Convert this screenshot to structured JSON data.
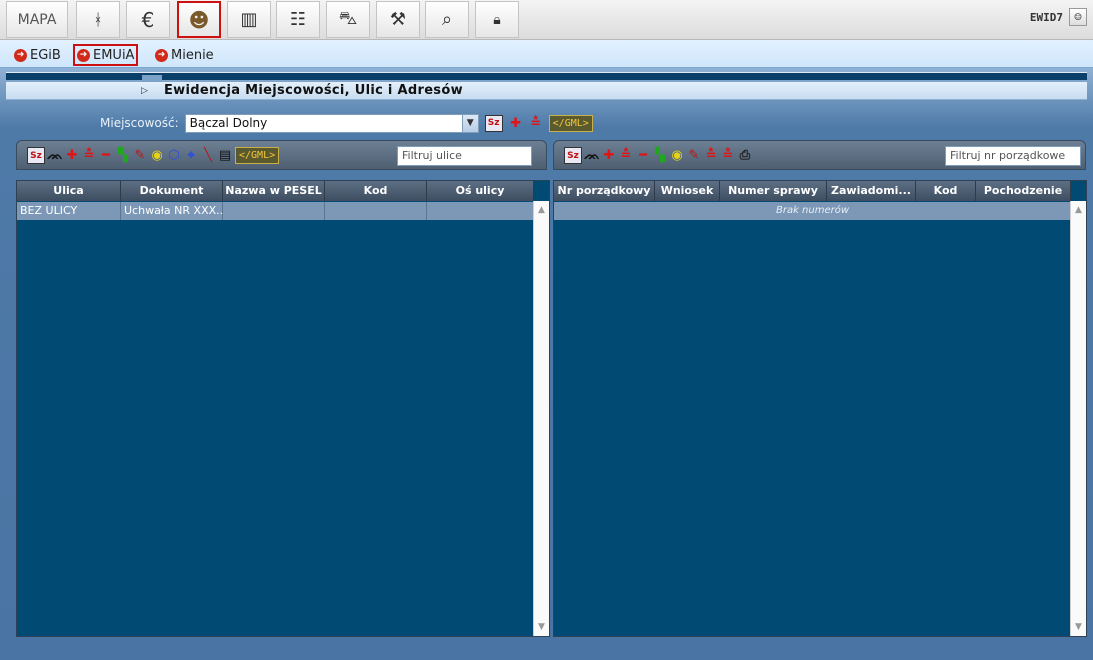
{
  "toolbar": {
    "mapa_label": "MAPA",
    "buttons": [
      {
        "icon": "surveyor-icon",
        "glyph": "⚗"
      },
      {
        "icon": "euro-icon",
        "glyph": "€"
      },
      {
        "icon": "person-icon",
        "glyph": "👤",
        "active": true
      },
      {
        "icon": "building-icon",
        "glyph": "🏢"
      },
      {
        "icon": "cabinet-icon",
        "glyph": "☷"
      },
      {
        "icon": "cart-icon",
        "glyph": "🛒"
      },
      {
        "icon": "gavel-icon",
        "glyph": "⚖"
      },
      {
        "icon": "search-icon",
        "glyph": "🔍"
      },
      {
        "icon": "lock-icon",
        "glyph": "🔒"
      }
    ],
    "user_label": "EWID7"
  },
  "subnav": {
    "items": [
      {
        "label": "EGiB",
        "active": false
      },
      {
        "label": "EMUiA",
        "active": true
      },
      {
        "label": "Mienie",
        "active": false
      }
    ]
  },
  "section": {
    "title": "Ewidencja Miejscowości, Ulic i Adresów"
  },
  "locality": {
    "label": "Miejscowość:",
    "value": "Bączal Dolny",
    "gml": "</GML>",
    "sz": "Sz"
  },
  "streets": {
    "filter_placeholder": "Filtruj ulice",
    "gml": "</GML>",
    "sz": "Sz",
    "columns": [
      "Ulica",
      "Dokument",
      "Nazwa w PESEL",
      "Kod",
      "Oś ulicy"
    ],
    "rows": [
      [
        "BEZ ULICY",
        "Uchwała NR XXX...",
        "",
        "",
        ""
      ]
    ]
  },
  "numbers": {
    "filter_placeholder": "Filtruj nr porządkowe",
    "sz": "Sz",
    "columns": [
      "Nr porządkowy",
      "Wniosek",
      "Numer sprawy",
      "Zawiadomi...",
      "Kod",
      "Pochodzenie"
    ],
    "empty_text": "Brak numerów"
  },
  "colors": {
    "accent_red": "#cc1111",
    "panel_blue": "#004a73",
    "row_blue": "#7c98b6"
  }
}
